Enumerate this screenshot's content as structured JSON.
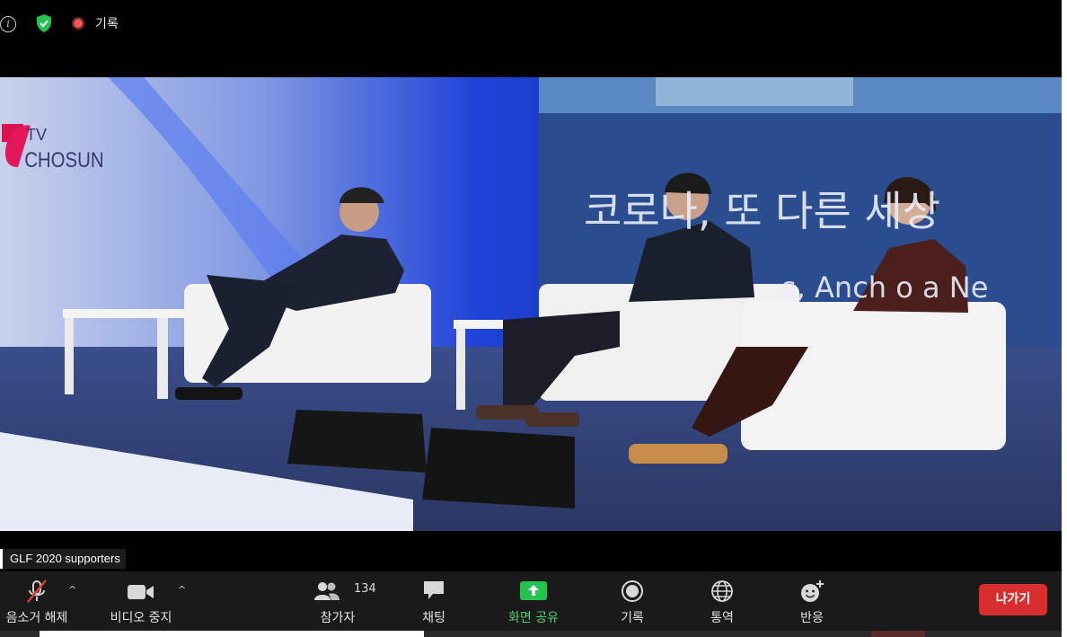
{
  "top_bar": {
    "info_glyph": "i",
    "recording_label": "기록"
  },
  "video": {
    "channel_logo": "TV CHOSUN",
    "stage_title": "코로나, 또 다른 세상",
    "stage_subtitle": "s, Anch    o a Ne"
  },
  "participant_name": "GLF 2020 supporters",
  "toolbar": {
    "unmute_label": "음소거 해제",
    "video_label": "비디오 중지",
    "participants_label": "참가자",
    "participants_count": "134",
    "chat_label": "채팅",
    "share_label": "화면 공유",
    "record_label": "기록",
    "interpret_label": "통역",
    "reactions_label": "반응",
    "leave_label": "나가기"
  },
  "colors": {
    "share_green": "#22c34f",
    "leave_red": "#d92e2e",
    "toolbar_bg": "#1a1a1a"
  }
}
